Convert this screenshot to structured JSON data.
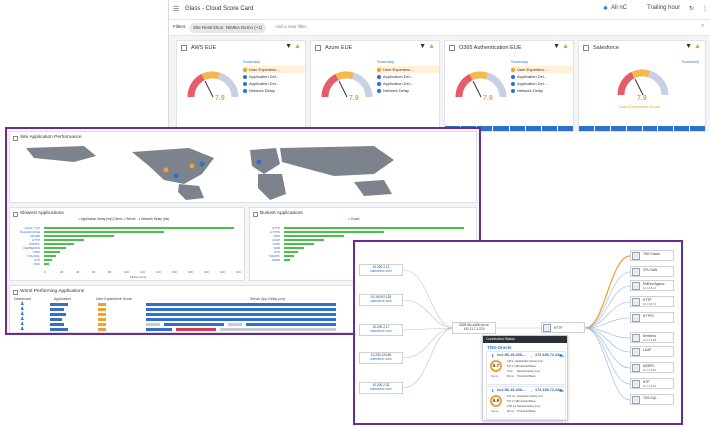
{
  "scorecards": {
    "title": "Glass - Cloud Score Card",
    "topright": {
      "scope": "All nC",
      "time": "Trailing hour"
    },
    "filters_label": "Filters:",
    "filter_chip": "Site Restriction: NIMBA Demo (+1)",
    "add_filter": "Add a new filter...",
    "legend_header": "Summary",
    "legend_items": [
      "User Experienc...",
      "Application Del...",
      "Application Del...",
      "Network Delay"
    ],
    "cards": [
      {
        "title": "AWS EUE",
        "score": "7.9"
      },
      {
        "title": "Azure EUE",
        "score": "7.9"
      },
      {
        "title": "O365 Authentication EUE",
        "score": "7.9"
      },
      {
        "title": "Salesforce",
        "score": "7.9",
        "caption": "User Experience Score"
      }
    ]
  },
  "app_perf": {
    "map_title": "Site Application Performance",
    "slowest_title": "Slowest Applications",
    "slowest_legend": [
      "Application Delay (ms) Client -> Server",
      "Network Delay (ms)"
    ],
    "slowest_xlabel": "Milliseconds",
    "slowest_ticks": [
      "0",
      "20",
      "40",
      "60",
      "80",
      "100",
      "120",
      "140",
      "160",
      "180",
      "200",
      "220",
      "240"
    ],
    "busiest_title": "Busiest Applications",
    "busiest_legend": "Count",
    "worst_title": "Worst Performing Applications",
    "worst_headers": [
      "Dashboard",
      "Application",
      "User Experience Score",
      "Server App Delay (ms)"
    ]
  },
  "path": {
    "sources": [
      {
        "ip": "10.200.2.13",
        "host": "salesforce.com"
      },
      {
        "ip": "10.100.92.120",
        "host": "salesforce.com"
      },
      {
        "ip": "10.200.2.17",
        "host": "salesforce.com"
      },
      {
        "ip": "10.200.120.80",
        "host": "salesforce.com"
      },
      {
        "ip": "10.200.2.32",
        "host": "salesforce.com"
      }
    ],
    "middle_node": {
      "line1": "0525-f8c-ca08-rfc-ue",
      "line2": "192.11.7.1.220"
    },
    "http_node": "HTTP",
    "targets": [
      {
        "name": "TNS Oracle",
        "sub": ""
      },
      {
        "name": "CPU DAN",
        "sub": ""
      },
      {
        "name": "ENEext Appsrv",
        "sub": "10.13.8.10"
      },
      {
        "name": "HTTP",
        "sub": "10.13.8.72"
      },
      {
        "name": "HTTPS",
        "sub": ""
      },
      {
        "name": "Kerberos",
        "sub": "10.13.8.68"
      },
      {
        "name": "LDAP",
        "sub": ""
      },
      {
        "name": "MSRPC",
        "sub": "10.13.8.50"
      },
      {
        "name": "NTP",
        "sub": "10.13.8.20"
      },
      {
        "name": "TDS-SQL",
        "sub": ""
      }
    ],
    "connection": {
      "header": "Connection Status",
      "name": "TNS-Oracle",
      "sections": [
        {
          "score": "6.7",
          "score_label": "Score",
          "from": "ec2-56-19-236-...",
          "to": "172.196.72.22",
          "metrics": [
            {
              "v": "146.1 ms",
              "k": "Application Delay (ms)"
            },
            {
              "v": "517.3 ms",
              "k": "Threshold Basis"
            },
            {
              "v": "0 ms",
              "k": "Network Delay (ms)"
            },
            {
              "v": "60 ms",
              "k": "Threshold Basis"
            }
          ]
        },
        {
          "score": "6.9",
          "score_label": "Score",
          "from": "ec2-56-19-236-...",
          "to": "172.196.72.22",
          "metrics": [
            {
              "v": "127 ms",
              "k": "Application Delay (ms)"
            },
            {
              "v": "517.3 ms",
              "k": "Threshold Basis"
            },
            {
              "v": "0.50 ms",
              "k": "Network Delay (ms)"
            },
            {
              "v": "60 ms",
              "k": "Threshold Basis"
            }
          ]
        }
      ]
    }
  },
  "colors": {
    "accent_purple": "#6b2c91",
    "blue": "#2f6fd0",
    "green": "#4bbf4b",
    "orange": "#f0a030"
  }
}
